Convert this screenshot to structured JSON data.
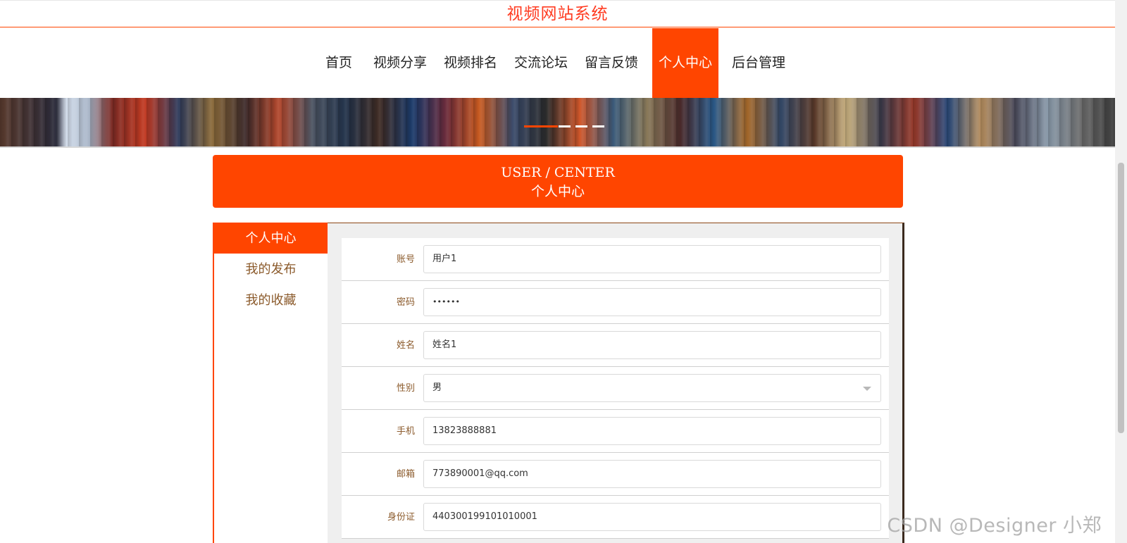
{
  "site": {
    "title": "视频网站系统"
  },
  "nav": {
    "items": [
      {
        "label": "首页",
        "active": false
      },
      {
        "label": "视频分享",
        "active": false
      },
      {
        "label": "视频排名",
        "active": false
      },
      {
        "label": "交流论坛",
        "active": false
      },
      {
        "label": "留言反馈",
        "active": false
      },
      {
        "label": "个人中心",
        "active": true
      },
      {
        "label": "后台管理",
        "active": false
      }
    ]
  },
  "banner": {
    "slide_count": 4,
    "active_slide": 1
  },
  "center_header": {
    "title_en": "USER / CENTER",
    "title_cn": "个人中心"
  },
  "sidebar": {
    "items": [
      {
        "label": "个人中心",
        "active": true
      },
      {
        "label": "我的发布",
        "active": false
      },
      {
        "label": "我的收藏",
        "active": false
      }
    ]
  },
  "form": {
    "fields": [
      {
        "label": "账号",
        "value": "用户1",
        "type": "text"
      },
      {
        "label": "密码",
        "value": "••••••",
        "type": "password"
      },
      {
        "label": "姓名",
        "value": "姓名1",
        "type": "text"
      },
      {
        "label": "性别",
        "value": "男",
        "type": "select"
      },
      {
        "label": "手机",
        "value": "13823888881",
        "type": "text"
      },
      {
        "label": "邮箱",
        "value": "773890001@qq.com",
        "type": "text"
      },
      {
        "label": "身份证",
        "value": "440300199101010001",
        "type": "text"
      }
    ]
  },
  "watermark": "CSDN @Designer 小郑",
  "colors": {
    "accent": "#ff4500",
    "title_red": "#ff3b21",
    "label_brown": "#8b5a2b"
  }
}
